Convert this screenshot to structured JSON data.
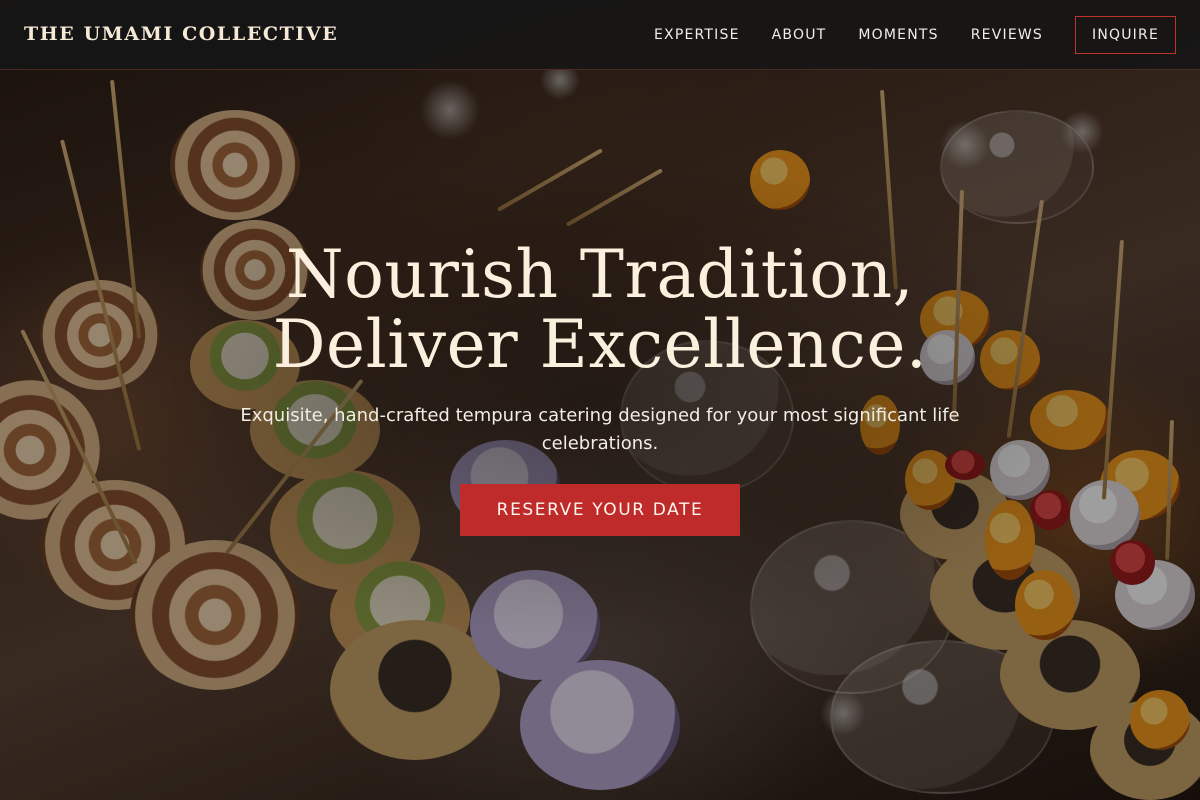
{
  "header": {
    "brand": "THE UMAMI COLLECTIVE",
    "nav": [
      {
        "label": "EXPERTISE"
      },
      {
        "label": "ABOUT"
      },
      {
        "label": "MOMENTS"
      },
      {
        "label": "REVIEWS"
      }
    ],
    "cta_label": "INQUIRE"
  },
  "hero": {
    "title_line1": "Nourish Tradition,",
    "title_line2": "Deliver Excellence.",
    "subtitle": "Exquisite, hand-crafted tempura catering designed for your most significant life celebrations.",
    "cta_label": "RESERVE YOUR DATE",
    "background_icon": "catering-food-photo"
  },
  "colors": {
    "accent": "#bf2a2a",
    "header_bg": "#161616",
    "title_text": "#fbf0dd"
  }
}
